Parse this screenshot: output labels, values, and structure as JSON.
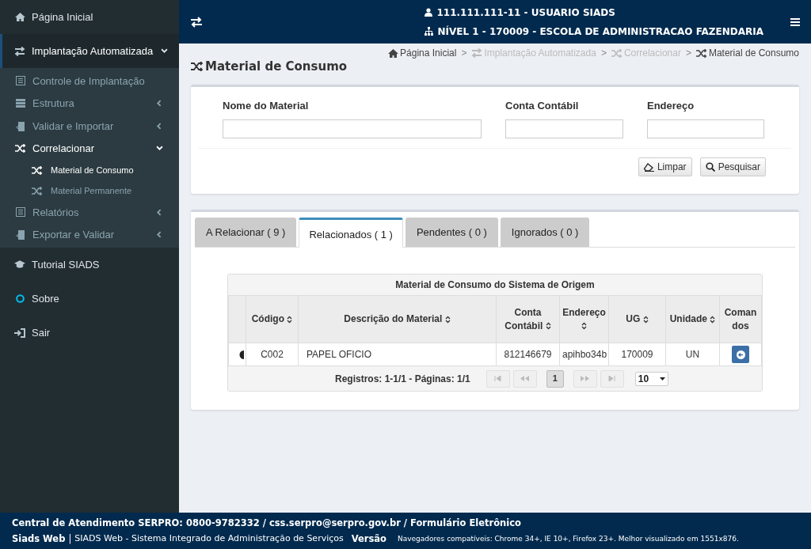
{
  "sidebar": {
    "items": [
      {
        "label": "Página Inicial",
        "kind": "link",
        "selected": false
      },
      {
        "label": "Implantação Automatizada",
        "kind": "group",
        "selected": true,
        "expanded": true,
        "children": [
          {
            "label": "Controle de Implantação",
            "kind": "link",
            "selected": false
          },
          {
            "label": "Estrutura",
            "kind": "group",
            "selected": false,
            "expanded": false
          },
          {
            "label": "Validar e Importar",
            "kind": "group",
            "selected": false,
            "expanded": false
          },
          {
            "label": "Correlacionar",
            "kind": "group",
            "selected": true,
            "expanded": true,
            "children": [
              {
                "label": "Material de Consumo",
                "selected": true
              },
              {
                "label": "Material Permanente",
                "selected": false
              }
            ]
          },
          {
            "label": "Relatórios",
            "kind": "group",
            "selected": false,
            "expanded": false
          },
          {
            "label": "Exportar e Validar",
            "kind": "group",
            "selected": false,
            "expanded": false
          }
        ]
      },
      {
        "label": "Tutorial SIADS",
        "kind": "link",
        "selected": false
      },
      {
        "label": "Sobre",
        "kind": "link",
        "selected": false
      },
      {
        "label": "Sair",
        "kind": "link",
        "selected": false
      }
    ]
  },
  "header": {
    "user": "111.111.111-11 - USUARIO SIADS",
    "unit": "NÍVEL 1 - 170009 - ESCOLA DE ADMINISTRACAO FAZENDARIA"
  },
  "page_title": "Material de Consumo",
  "breadcrumb": [
    {
      "label": "Página Inicial",
      "disabled": false
    },
    {
      "label": "Implantação Automatizada",
      "disabled": true
    },
    {
      "label": "Correlacionar",
      "disabled": true
    },
    {
      "label": "Material de Consumo",
      "disabled": false
    }
  ],
  "breadcrumb_separator": ">",
  "search_form": {
    "fields": [
      {
        "label": "Nome do Material"
      },
      {
        "label": "Conta Contábil"
      },
      {
        "label": "Endereço"
      }
    ],
    "buttons": [
      "Limpar",
      "Pesquisar"
    ]
  },
  "tabs": [
    {
      "label": "A Relacionar ( 9 )",
      "selected": false
    },
    {
      "label": "Relacionados ( 1 )",
      "selected": true
    },
    {
      "label": "Pendentes ( 0 )",
      "selected": false
    },
    {
      "label": "Ignorados ( 0 )",
      "selected": false
    }
  ],
  "table": {
    "caption": "Material de Consumo do Sistema de Origem",
    "columns": [
      {
        "label": "Código",
        "sortable": true
      },
      {
        "label": "Descrição do Material",
        "sortable": true
      },
      {
        "label": "Conta Contábil",
        "sortable": true
      },
      {
        "label": "Endereço",
        "sortable": true
      },
      {
        "label": "UG",
        "sortable": true
      },
      {
        "label": "Unidade",
        "sortable": true
      },
      {
        "label": "Comandos",
        "sortable": false
      }
    ],
    "rows": [
      [
        "C002",
        "PAPEL OFICIO",
        "812146679",
        "apihbo34b",
        "170009",
        "UN"
      ]
    ],
    "records": "Registros: 1-1/1 - Páginas: 1/1",
    "pages": [
      {
        "label": "1",
        "selected": true
      }
    ],
    "page_size": "10"
  },
  "footer": {
    "contact": "Central de Atendimento SERPRO: 0800-9782332 / css.serpro@serpro.gov.br / Formulário Eletrônico",
    "app": "Siads Web",
    "separator": "|",
    "system": "SIADS Web - Sistema Integrado de Administração de Serviços",
    "version": "Versão",
    "browsers": "Navegadores compatíveis: Chrome 34+, IE 10+, Firefox 23+. Melhor visualizado em 1551x876."
  }
}
